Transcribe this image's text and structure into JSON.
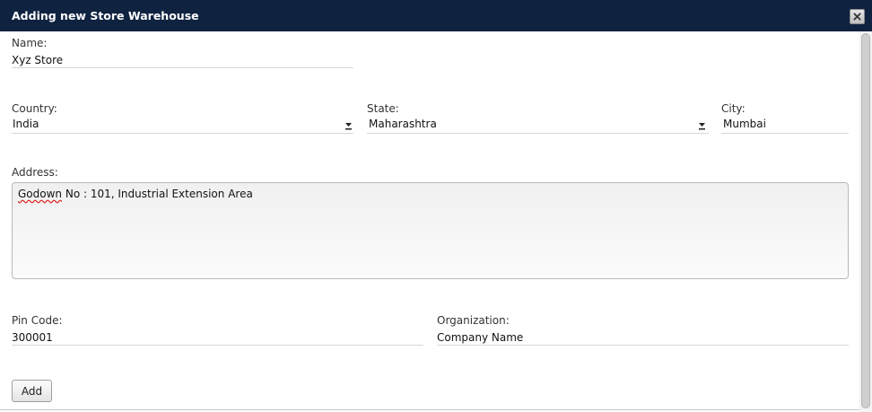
{
  "dialog": {
    "title": "Adding new Store Warehouse",
    "close_icon": "close-x-icon"
  },
  "form": {
    "name": {
      "label": "Name:",
      "value": "Xyz Store"
    },
    "country": {
      "label": "Country:",
      "value": "India"
    },
    "state": {
      "label": "State:",
      "value": "Maharashtra"
    },
    "city": {
      "label": "City:",
      "value": "Mumbai"
    },
    "address": {
      "label": "Address:",
      "value_misspelled": "Godown",
      "value_rest": " No : 101, Industrial Extension Area"
    },
    "pin_code": {
      "label": "Pin Code:",
      "value": "300001"
    },
    "organization": {
      "label": "Organization:",
      "value": "Company Name"
    },
    "add_button": "Add"
  },
  "colors": {
    "titlebar": "#0f2341",
    "field_underline": "#d6d6d6"
  }
}
